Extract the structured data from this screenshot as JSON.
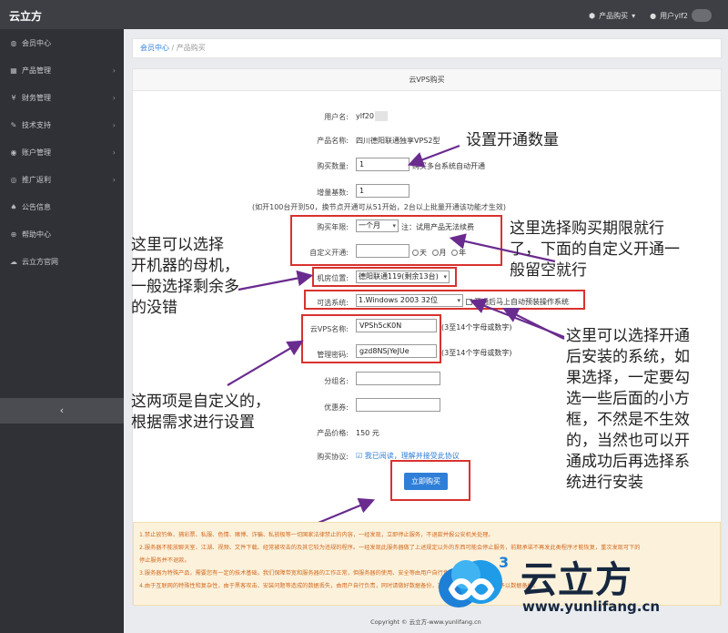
{
  "topbar": {
    "brand": "云立方",
    "product_buy": "产品购买",
    "user_name": "用户ylf2"
  },
  "sidebar": {
    "items": [
      {
        "label": "会员中心",
        "icon": "dashboard-icon",
        "has_chevron": false
      },
      {
        "label": "产品管理",
        "icon": "grid-icon",
        "has_chevron": true
      },
      {
        "label": "财务管理",
        "icon": "yen-icon",
        "has_chevron": true
      },
      {
        "label": "技术支持",
        "icon": "wrench-icon",
        "has_chevron": true
      },
      {
        "label": "账户管理",
        "icon": "user-icon",
        "has_chevron": true
      },
      {
        "label": "推广返利",
        "icon": "eye-icon",
        "has_chevron": true
      },
      {
        "label": "公告信息",
        "icon": "bell-icon",
        "has_chevron": false
      },
      {
        "label": "帮助中心",
        "icon": "help-icon",
        "has_chevron": false
      },
      {
        "label": "云立方官网",
        "icon": "cloud-icon",
        "has_chevron": false
      }
    ],
    "collapse_glyph": "‹"
  },
  "breadcrumb": {
    "home": "会员中心",
    "sep": "/",
    "current": "产品购买"
  },
  "panel": {
    "title": "云VPS购买"
  },
  "form": {
    "username_label": "用户名:",
    "username_value": "ylf20",
    "product_label": "产品名称:",
    "product_value": "四川德阳联通独享VPS2型",
    "qty_label": "购买数量:",
    "qty_value": "1",
    "qty_note": "购买多台系统自动开通",
    "inc_label": "增量基数:",
    "inc_value": "1",
    "inc_note": "(如开100台开到50，换节点开通可从51开始，2台以上批量开通该功能才生效)",
    "period_label": "购买年限:",
    "period_value": "一个月",
    "period_note": "注：试用产品无法续费",
    "custom_label": "自定义开通:",
    "custom_value": "",
    "unit_day": "天",
    "unit_month": "月",
    "unit_year": "年",
    "room_label": "机房位置:",
    "room_value": "德阳联通119(剩余13台)",
    "os_label": "可选系统:",
    "os_value": "1.Windows 2003 32位",
    "os_auto_label": "开通后马上自动预装操作系统",
    "vps_name_label": "云VPS名称:",
    "vps_name_value": "VPSh5cK0N",
    "vps_name_hint": "(3至14个字母或数字)",
    "pwd_label": "管理密码:",
    "pwd_value": "gzd8NSjYeJUe",
    "pwd_hint": "(3至14个字母或数字)",
    "group_label": "分组名:",
    "coupon_label": "优惠券:",
    "price_label": "产品价格:",
    "price_value": "150 元",
    "agree_label": "购买协议:",
    "agree_text": "我已阅读，理解并接受此协议",
    "buy_button": "立即购买"
  },
  "notice": {
    "lines": [
      "1.禁止放钓鱼、捕彩票、私服、色情、赌博、诈骗、私放极等一切国家法律禁止的内容，一经发现，立即停止服务，不退款并报公安机关处理。",
      "2.服务器不能放聊天室、江湖、视频、文件下载、经常被攻击的及其它较为违规的程序。一经发现此服务器做了上述规定以外的东西可能会停止服务，前期承诺不再发此类程序才能恢复，重次发现可下的",
      "停止服务并不退款。",
      "3.服务器为特殊产品，需要您有一定的技术基础，我们保障带宽和服务器的工作正常，但服务器的使用、安全等由用户自行负责。",
      "4.由于互联网的特殊性和复杂性，由于黑客攻击、安装问题等造成的数据丢失，由用户自行负责，同时请做好数据备份，对于此类问题，本公司不予以数据备份。"
    ]
  },
  "footer": {
    "text": "Copyright © 云立方-www.yunlifang.cn"
  },
  "annotations": {
    "qty": "设置开通数量",
    "period": [
      "这里选择购买期限就行",
      "了，下面的自定义开通一",
      "般留空就行"
    ],
    "room": [
      "这里可以选择",
      "开机器的母机，",
      "一般选择剩余多",
      "的没错"
    ],
    "os": [
      "这里可以选择开通",
      "后安装的系统，如",
      "果选择，一定要勾",
      "选一些后面的小方",
      "框，不然是不生效",
      "的，当然也可以开",
      "通成功后再选择系",
      "统进行安装"
    ],
    "custom": [
      "这两项是自定义的，",
      "根据需求进行设置"
    ]
  },
  "watermark": {
    "cn": "云立方",
    "url": "www.yunlifang.cn",
    "badge": "3"
  }
}
